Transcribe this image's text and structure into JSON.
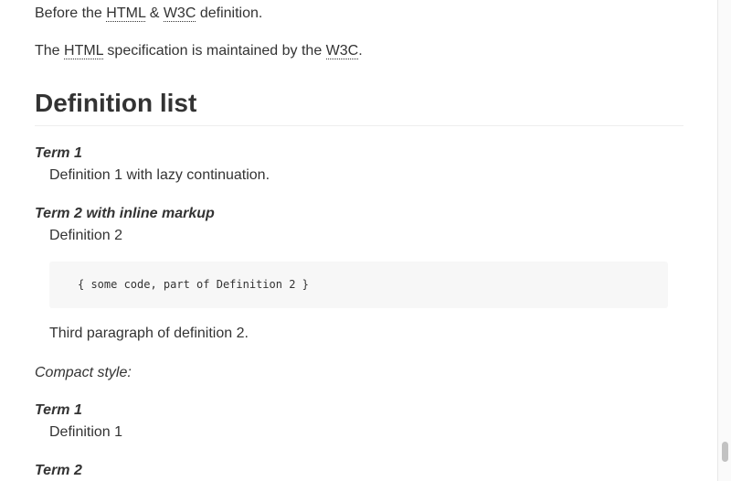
{
  "para1": {
    "before": "Before the ",
    "abbr1": "HTML",
    "between": " & ",
    "abbr2": "W3C",
    "after": " definition."
  },
  "para2": {
    "before": "The ",
    "abbr1": "HTML",
    "between": " specification is maintained by the ",
    "abbr2": "W3C",
    "after": "."
  },
  "heading": "Definition list",
  "list1": [
    {
      "term": "Term 1",
      "definition": "Definition 1 with lazy continuation."
    },
    {
      "term": "Term 2 with inline markup",
      "definition": "Definition 2"
    }
  ],
  "code_block": "{ some code, part of Definition 2 }",
  "third_paragraph": "Third paragraph of definition 2.",
  "compact_label": "Compact style:",
  "list2": [
    {
      "term": "Term 1",
      "definition": "Definition 1"
    },
    {
      "term": "Term 2",
      "definition": ""
    }
  ]
}
